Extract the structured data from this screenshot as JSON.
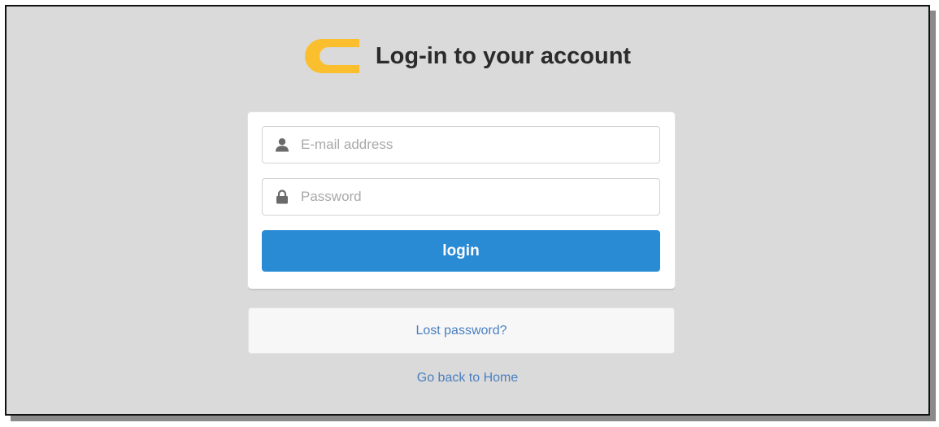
{
  "header": {
    "title": "Log-in to your account",
    "logo_icon": "yellow-c-logo",
    "logo_color": "#fbbf2d"
  },
  "form": {
    "email": {
      "placeholder": "E-mail address",
      "value": "",
      "icon": "user-icon"
    },
    "password": {
      "placeholder": "Password",
      "value": "",
      "icon": "lock-icon"
    },
    "login_label": "login",
    "login_color": "#2a8bd5"
  },
  "links": {
    "lost_password": "Lost password?",
    "go_home": "Go back to Home",
    "link_color": "#4a7fc1"
  }
}
